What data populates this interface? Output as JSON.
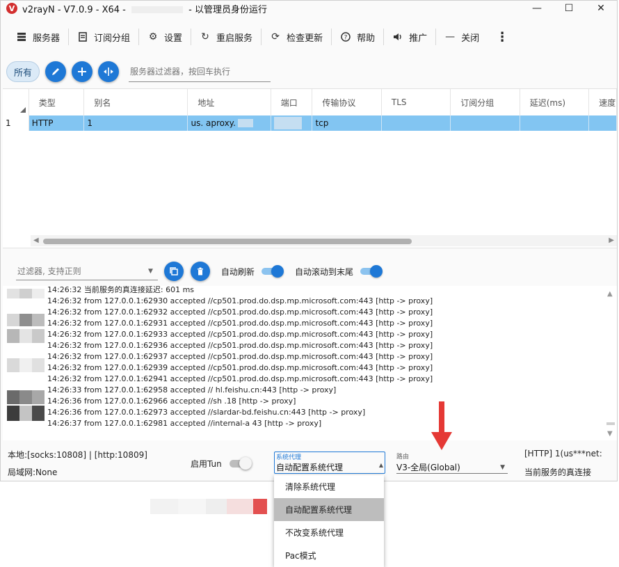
{
  "window": {
    "title_prefix": "v2rayN - V7.0.9 - X64 - ",
    "title_suffix": " - 以管理员身份运行",
    "logo_glyph": "V",
    "minimize": "—",
    "maximize": "☐",
    "close": "✕"
  },
  "toolbar": {
    "servers": "服务器",
    "subscriptions": "订阅分组",
    "settings": "设置",
    "restart": "重启服务",
    "check_update": "检查更新",
    "help": "帮助",
    "promote": "推广",
    "close": "关闭",
    "more": "⋮"
  },
  "server_filter": {
    "all_chip": "所有",
    "placeholder": "服务器过滤器，按回车执行"
  },
  "grid": {
    "columns": [
      "类型",
      "别名",
      "地址",
      "端口",
      "传输协议",
      "TLS",
      "订阅分组",
      "延迟(ms)",
      "速度"
    ],
    "rows": [
      {
        "index": "1",
        "type": "HTTP",
        "alias": "1",
        "address": "us.  aproxy.",
        "port": "",
        "transport": "tcp",
        "tls": "",
        "sub": "",
        "delay": ""
      }
    ]
  },
  "log_toolbar": {
    "placeholder": "过滤器, 支持正则",
    "auto_refresh": "自动刷新",
    "auto_scroll": "自动滚动到末尾"
  },
  "log_lines": [
    "14:26:32 当前服务的真连接延迟: 601 ms",
    "14:26:32 from 127.0.0.1:62930 accepted //cp501.prod.do.dsp.mp.microsoft.com:443 [http -> proxy]",
    "14:26:32 from 127.0.0.1:62932 accepted //cp501.prod.do.dsp.mp.microsoft.com:443 [http -> proxy]",
    "14:26:32 from 127.0.0.1:62931 accepted //cp501.prod.do.dsp.mp.microsoft.com:443 [http -> proxy]",
    "14:26:32 from 127.0.0.1:62933 accepted //cp501.prod.do.dsp.mp.microsoft.com:443 [http -> proxy]",
    "14:26:32 from 127.0.0.1:62936 accepted //cp501.prod.do.dsp.mp.microsoft.com:443 [http -> proxy]",
    "14:26:32 from 127.0.0.1:62937 accepted //cp501.prod.do.dsp.mp.microsoft.com:443 [http -> proxy]",
    "14:26:32 from 127.0.0.1:62939 accepted //cp501.prod.do.dsp.mp.microsoft.com:443 [http -> proxy]",
    "14:26:32 from 127.0.0.1:62941 accepted //cp501.prod.do.dsp.mp.microsoft.com:443 [http -> proxy]",
    "14:26:33 from 127.0.0.1:62958 accepted //                    hl.feishu.cn:443 [http -> proxy]",
    "14:26:36 from 127.0.0.1:62966 accepted //sh          .18 [http -> proxy]",
    "14:26:36 from 127.0.0.1:62973 accepted //slardar-bd.feishu.cn:443 [http -> proxy]",
    "14:26:37 from 127.0.0.1:62981 accepted //internal-a                 43 [http -> proxy]"
  ],
  "status": {
    "local": "本地:[socks:10808] | [http:10809]",
    "lan": "局域网:None",
    "tun_label": "启用Tun",
    "sys_proxy_label": "系统代理",
    "sys_proxy_value": "自动配置系统代理",
    "route_label": "路由",
    "route_value": "V3-全局(Global)",
    "server": "[HTTP] 1(us***net:",
    "delay": "当前服务的真连接"
  },
  "sys_proxy_menu": [
    "清除系统代理",
    "自动配置系统代理",
    "不改变系统代理",
    "Pac模式"
  ],
  "colors": {
    "accent": "#1e78d6",
    "selected_row": "#82c5f2",
    "annotation_arrow": "#e53935",
    "logo": "#d32f2f"
  },
  "icons": {
    "servers": "server-list-icon",
    "subscriptions": "subscription-icon",
    "settings": "gear-icon",
    "restart": "restart-icon",
    "check_update": "update-icon",
    "help": "help-icon",
    "promote": "speaker-icon",
    "close": "minus-icon"
  }
}
